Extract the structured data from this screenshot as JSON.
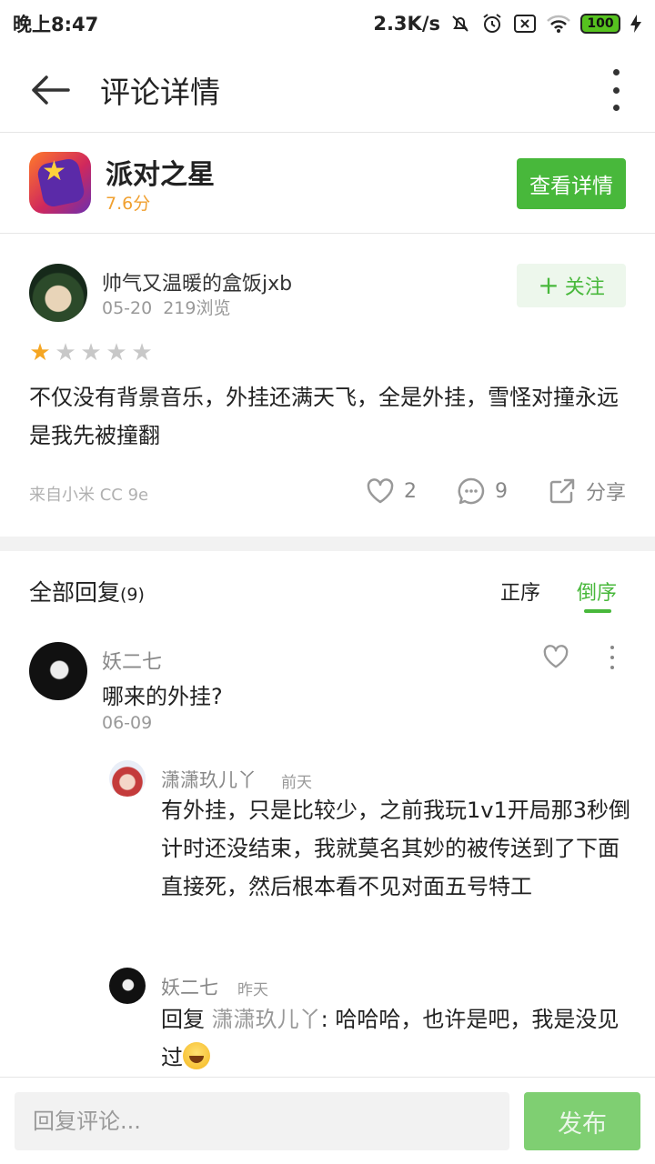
{
  "status_bar": {
    "time": "晚上8:47",
    "speed": "2.3K/s",
    "battery": "100"
  },
  "header": {
    "title": "评论详情"
  },
  "app": {
    "name": "派对之星",
    "score": "7.6分",
    "detail_button": "查看详情"
  },
  "review": {
    "author": "帅气又温暖的盒饭jxb",
    "date": "05-20",
    "views": "219浏览",
    "follow_label": "关注",
    "rating": 1,
    "rating_max": 5,
    "text": "不仅没有背景音乐，外挂还满天飞，全是外挂，雪怪对撞永远是我先被撞翻",
    "device": "来自小米 CC 9e",
    "likes": "2",
    "comments": "9",
    "share_label": "分享"
  },
  "replies": {
    "title": "全部回复",
    "count": "(9)",
    "sort_asc": "正序",
    "sort_desc": "倒序",
    "items": [
      {
        "name": "妖二七",
        "text": "哪来的外挂?",
        "date": "06-09",
        "sub_replies": [
          {
            "name": "潇潇玖儿丫",
            "time": "前天",
            "text": "有外挂，只是比较少，之前我玩1v1开局那3秒倒计时还没结束，我就莫名其妙的被传送到了下面直接死，然后根本看不见对面五号特工"
          },
          {
            "name": "妖二七",
            "time": "昨天",
            "reply_prefix": "回复",
            "mention": "潇潇玖儿丫",
            "text": ": 哈哈哈，也许是吧，我是没见过"
          }
        ]
      }
    ]
  },
  "bottom": {
    "input_placeholder": "回复评论...",
    "publish_label": "发布"
  },
  "colors": {
    "accent_green": "#48b83b",
    "star_on": "#f5a623",
    "score_orange": "#f0a030"
  }
}
